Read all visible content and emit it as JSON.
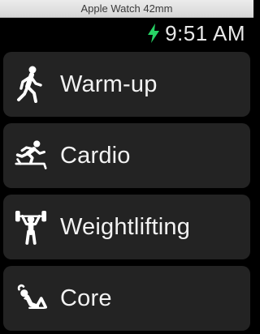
{
  "window": {
    "title": "Apple Watch 42mm"
  },
  "status": {
    "time": "9:51 AM",
    "charging_color": "#27d365",
    "charging_icon": "lightning-bolt-icon"
  },
  "menu": {
    "items": [
      {
        "label": "Warm-up",
        "icon": "walking-person-icon"
      },
      {
        "label": "Cardio",
        "icon": "treadmill-runner-icon"
      },
      {
        "label": "Weightlifting",
        "icon": "weightlifter-icon"
      },
      {
        "label": "Core",
        "icon": "situp-icon"
      }
    ]
  }
}
